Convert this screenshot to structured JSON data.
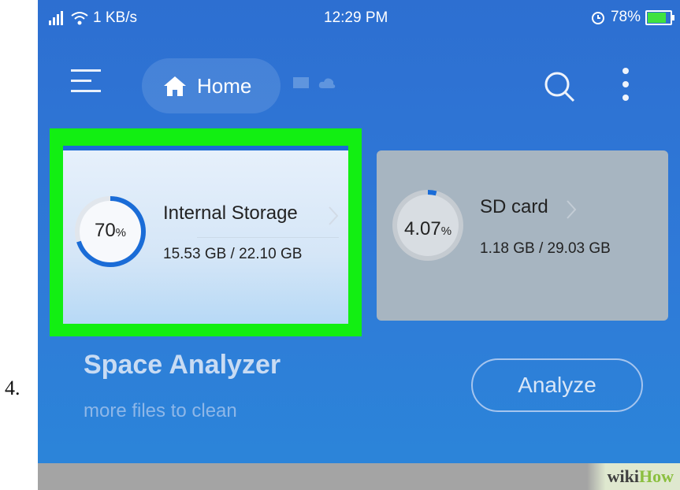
{
  "step_number": "4.",
  "status_bar": {
    "network_speed": "1 KB/s",
    "time": "12:29 PM",
    "battery": "78%",
    "battery_level": 0.78
  },
  "toolbar": {
    "home_label": "Home"
  },
  "storage_cards": [
    {
      "percent_value": "70",
      "percent_sign": "%",
      "usage_fraction": 0.7,
      "title": "Internal Storage",
      "size": "15.53 GB / 22.10 GB"
    },
    {
      "percent_value": "4.07",
      "percent_sign": "%",
      "usage_fraction": 0.0407,
      "title": "SD card",
      "size": "1.18 GB / 29.03 GB"
    }
  ],
  "space_analyzer": {
    "title": "Space Analyzer",
    "subtitle": "more files to clean",
    "button_label": "Analyze"
  },
  "watermark": {
    "wiki": "wiki",
    "how": "How"
  },
  "colors": {
    "accent_blue": "#1a6cd7",
    "highlight_green": "#12ef12"
  }
}
